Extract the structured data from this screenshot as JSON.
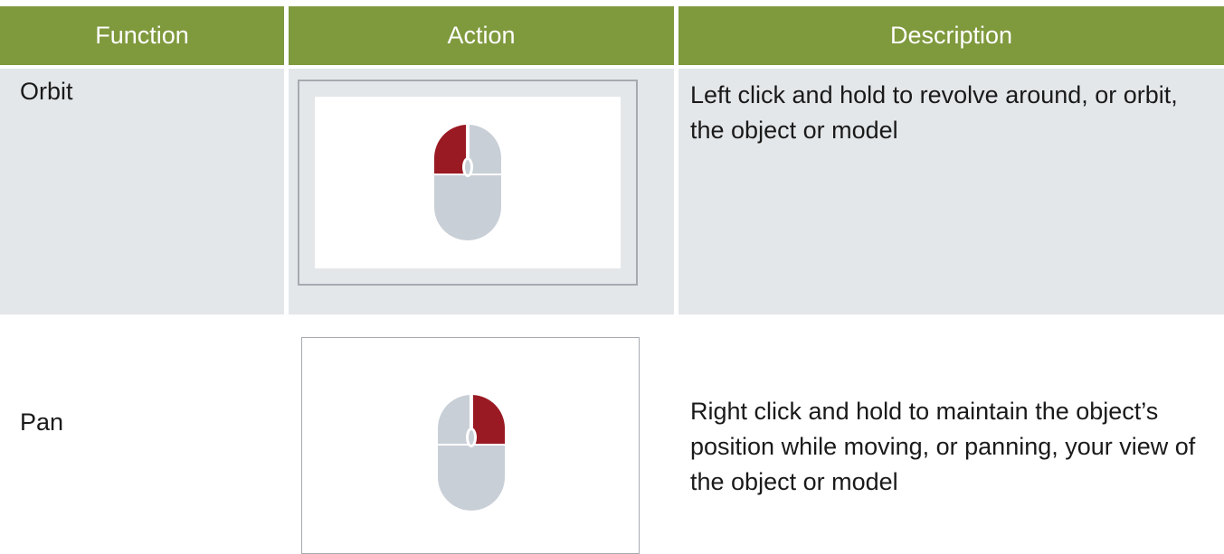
{
  "header": {
    "function_label": "Function",
    "action_label": "Action",
    "description_label": "Description"
  },
  "rows": [
    {
      "function": "Orbit",
      "action_icon": "mouse-left-click-icon",
      "description": "Left click and hold to revolve around, or orbit, the object or model"
    },
    {
      "function": "Pan",
      "action_icon": "mouse-right-click-icon",
      "description": "Right click and hold to maintain the object’s position while moving, or panning, your view of the object or model"
    }
  ],
  "colors": {
    "header_bg": "#7f993d",
    "row_bg": "#e4e7ea",
    "mouse_body": "#c9cfd7",
    "mouse_active": "#9a1a23"
  }
}
